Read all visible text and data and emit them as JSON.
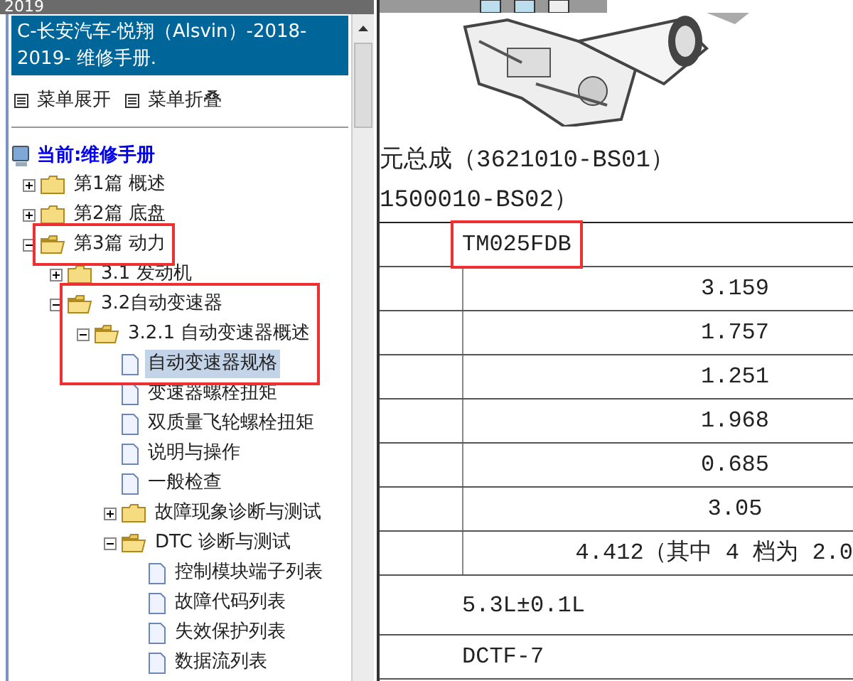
{
  "window": {
    "title": "2019"
  },
  "sidebar": {
    "header": "C-长安汽车-悦翔（Alsvin）-2018-2019- 维修手册.",
    "menu_buttons": [
      "菜单展开",
      "菜单折叠"
    ],
    "current": "当前:维修手册",
    "tree": [
      {
        "label": "第1篇 概述",
        "kind": "folder",
        "expanded": false,
        "selected": false
      },
      {
        "label": "第2篇 底盘",
        "kind": "folder",
        "expanded": false,
        "selected": false
      },
      {
        "label": "第3篇 动力",
        "kind": "folder",
        "expanded": true,
        "selected": false,
        "highlighted": true,
        "children": [
          {
            "label": "3.1 发动机",
            "kind": "folder",
            "expanded": false,
            "selected": false
          },
          {
            "label": "3.2自动变速器",
            "kind": "folder",
            "expanded": true,
            "selected": false,
            "highlighted": true,
            "children": [
              {
                "label": "3.2.1 自动变速器概述",
                "kind": "folder",
                "expanded": true,
                "selected": false,
                "highlighted": true,
                "children": [
                  {
                    "label": "自动变速器规格",
                    "kind": "page",
                    "selected": true,
                    "highlighted": true
                  },
                  {
                    "label": "变速器螺栓扭矩",
                    "kind": "page",
                    "selected": false
                  },
                  {
                    "label": "双质量飞轮螺栓扭矩",
                    "kind": "page",
                    "selected": false
                  },
                  {
                    "label": "说明与操作",
                    "kind": "page",
                    "selected": false
                  },
                  {
                    "label": "一般检查",
                    "kind": "page",
                    "selected": false
                  },
                  {
                    "label": "故障现象诊断与测试",
                    "kind": "folder",
                    "expanded": false,
                    "selected": false
                  },
                  {
                    "label": "DTC 诊断与测试",
                    "kind": "folder",
                    "expanded": true,
                    "selected": false,
                    "children": [
                      {
                        "label": "控制模块端子列表",
                        "kind": "page",
                        "selected": false
                      },
                      {
                        "label": "故障代码列表",
                        "kind": "page",
                        "selected": false
                      },
                      {
                        "label": "失效保护列表",
                        "kind": "page",
                        "selected": false
                      },
                      {
                        "label": "数据流列表",
                        "kind": "page",
                        "selected": false
                      }
                    ]
                  }
                ]
              }
            ]
          }
        ]
      }
    ]
  },
  "document": {
    "lines": [
      "元总成（3621010-BS01）",
      "1500010-BS02）"
    ],
    "table": [
      {
        "kind": "span",
        "text": "TM025FDB",
        "highlighted": true
      },
      {
        "kind": "value",
        "text": "3.159"
      },
      {
        "kind": "value",
        "text": "1.757"
      },
      {
        "kind": "value",
        "text": "1.251"
      },
      {
        "kind": "value",
        "text": "1.968"
      },
      {
        "kind": "value",
        "text": "0.685"
      },
      {
        "kind": "value",
        "text": "3.05"
      },
      {
        "kind": "value_cut",
        "text": "4.412（其中 4 档为 2.0"
      },
      {
        "kind": "span",
        "text": "5.3L±0.1L"
      },
      {
        "kind": "span",
        "text": "DCTF-7"
      }
    ]
  }
}
